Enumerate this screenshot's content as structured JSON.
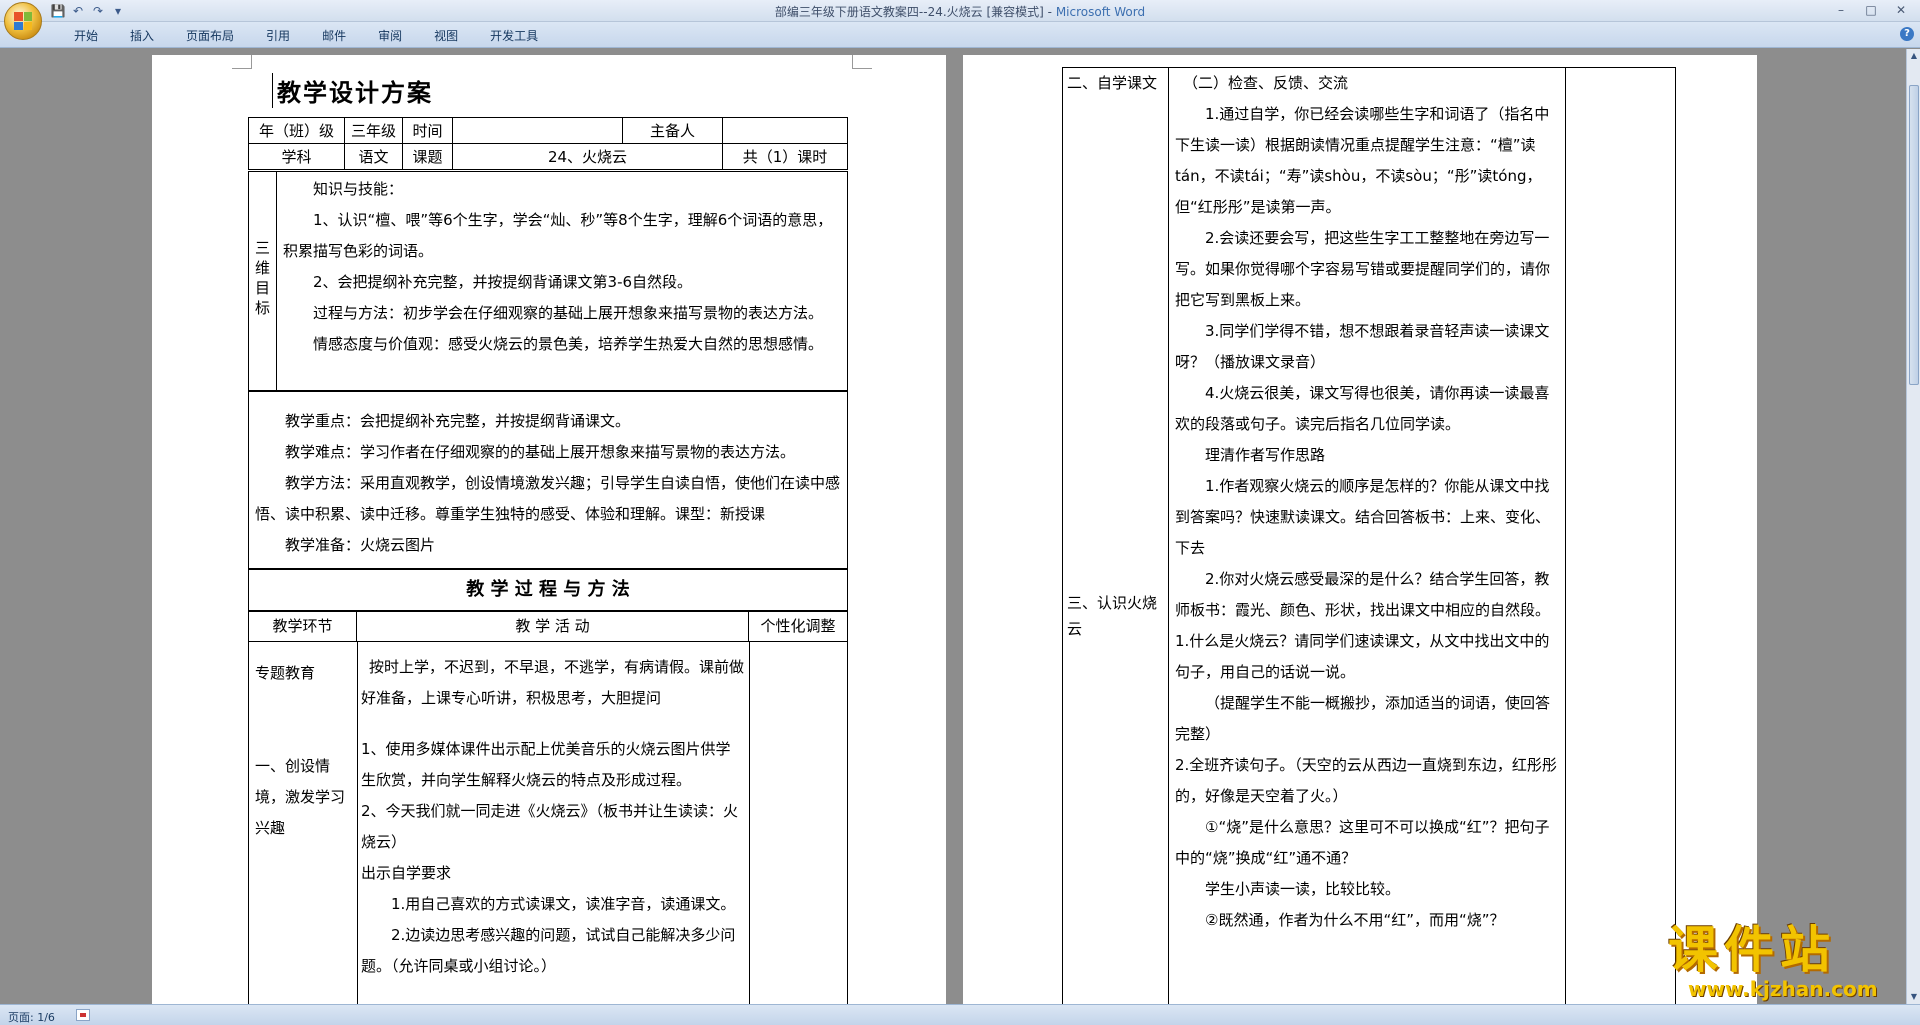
{
  "window": {
    "title": "部编三年级下册语文教案四--24.火烧云 [兼容模式]",
    "app_name": "Microsoft Word",
    "separator": " - ",
    "min": "–",
    "max": "□",
    "close": "✕"
  },
  "qat": {
    "save": "💾",
    "undo": "↶",
    "redo": "↷",
    "more": "▾"
  },
  "tabs": [
    "开始",
    "插入",
    "页面布局",
    "引用",
    "邮件",
    "审阅",
    "视图",
    "开发工具"
  ],
  "help": "?",
  "status": {
    "page": "页面: 1/6"
  },
  "page1": {
    "title": "教学设计方案",
    "header_row1": [
      "年（班）级",
      "三年级",
      "时间",
      "",
      "主备人",
      ""
    ],
    "header_row2": [
      "学科",
      "语文",
      "课题",
      "24、火烧云",
      "共（1）课时"
    ],
    "goal_label": "三维目标",
    "goals": [
      "知识与技能：",
      "1、认识“檀、喂”等6个生字，学会“灿、秒”等8个生字，理解6个词语的意思，积累描写色彩的词语。",
      "2、会把提纲补充完整，并按提纲背诵课文第3-6自然段。",
      "过程与方法：初步学会在仔细观察的基础上展开想象来描写景物的表达方法。",
      "情感态度与价值观：感受火烧云的景色美，培养学生热爱大自然的思想感情。"
    ],
    "key_points": [
      "教学重点：会把提纲补充完整，并按提纲背诵课文。",
      "教学难点：学习作者在仔细观察的的基础上展开想象来描写景物的表达方法。",
      "教学方法：采用直观教学，创设情境激发兴趣；引导学生自读自悟，使他们在读中感悟、读中积累、读中迁移。尊重学生独特的感受、体验和理解。课型：新授课",
      "教学准备：火烧云图片"
    ],
    "process_title": "教 学 过 程 与 方 法",
    "col_headers": [
      "教学环节",
      "教 学 活 动",
      "个性化调整"
    ],
    "left_col": [
      "专题教育",
      "一、创设情境，激发学习兴趣"
    ],
    "activities": [
      "按时上学，不迟到，不早退，不逃学，有病请假。课前做好准备，上课专心听讲，积极思考，大胆提问",
      "1、使用多媒体课件出示配上优美音乐的火烧云图片供学生欣赏，并向学生解释火烧云的特点及形成过程。",
      "2、今天我们就一同走进《火烧云》（板书并让生读读：火烧云）",
      "出示自学要求",
      "1.用自己喜欢的方式读课文，读准字音，读通课文。",
      "2.边读边思考感兴趣的问题，试试自己能解决多少问题。（允许同桌或小组讨论。）"
    ]
  },
  "page2": {
    "left_col": [
      "二、自学课文",
      "三、认识火烧云"
    ],
    "paras": [
      "（二）检查、反馈、交流",
      "1.通过自学，你已经会读哪些生字和词语了（指名中下生读一读）根据朗读情况重点提醒学生注意：“檀”读tán，不读tái；“寿”读shòu，不读sòu；“彤”读tóng，但“红彤彤”是读第一声。",
      "2.会读还要会写，把这些生字工工整整地在旁边写一写。如果你觉得哪个字容易写错或要提醒同学们的，请你把它写到黑板上来。",
      "3.同学们学得不错，想不想跟着录音轻声读一读课文呀？（播放课文录音）",
      "4.火烧云很美，课文写得也很美，请你再读一读最喜欢的段落或句子。读完后指名几位同学读。",
      "理清作者写作思路",
      "1.作者观察火烧云的顺序是怎样的？你能从课文中找到答案吗？快速默读课文。结合回答板书：上来、变化、下去",
      "2.你对火烧云感受最深的是什么？结合学生回答，教师板书：霞光、颜色、形状，找出课文中相应的自然段。",
      "1.什么是火烧云？请同学们速读课文，从文中找出文中的句子，用自己的话说一说。",
      "（提醒学生不能一概搬抄，添加适当的词语，使回答完整）",
      "2.全班齐读句子。（天空的云从西边一直烧到东边，红彤彤的，好像是天空着了火。）",
      "①“烧”是什么意思？这里可不可以换成“红”？把句子中的“烧”换成“红”通不通？",
      "学生小声读一读，比较比较。",
      "②既然通，作者为什么不用“红”，而用“烧”？"
    ]
  },
  "watermark": {
    "text": "课件站",
    "url": "www.kjzhan.com"
  },
  "colors": {
    "ribbon": "#c7d7ec",
    "doc_bg": "#8d8d8d",
    "accent": "#3c6fb0",
    "watermark": "#f2c300"
  }
}
